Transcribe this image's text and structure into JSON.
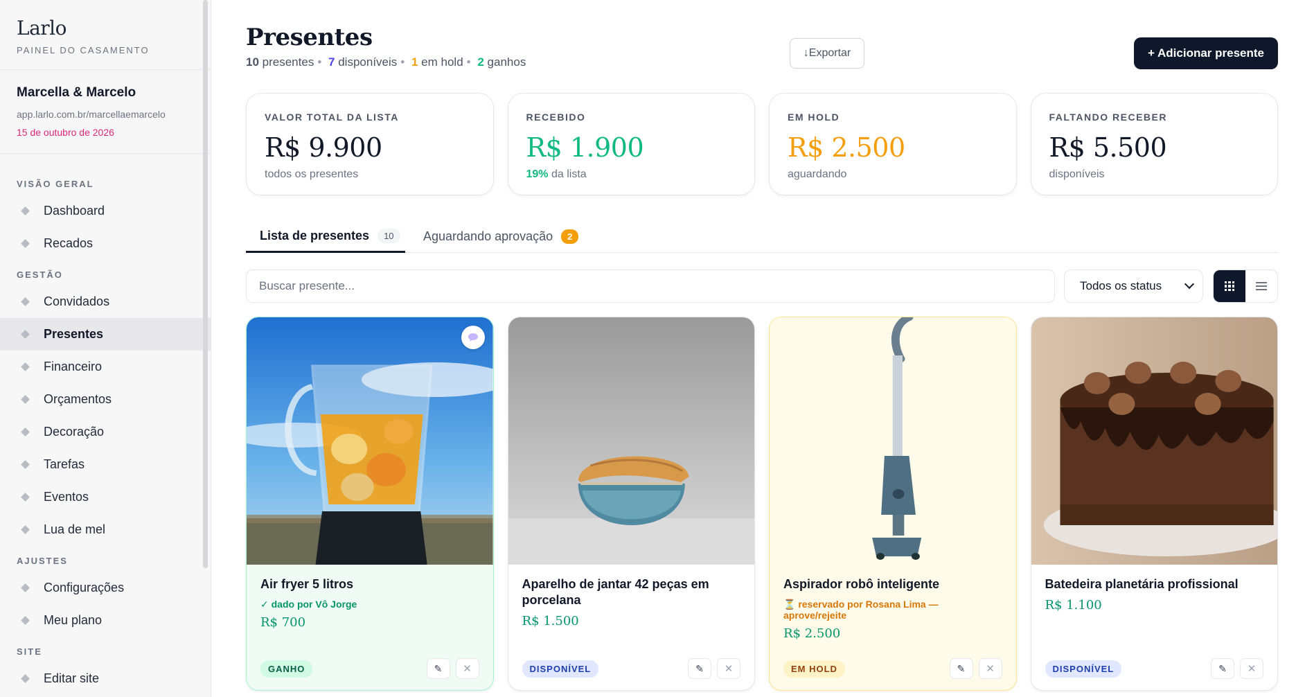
{
  "sidebar": {
    "brand": "Larlo",
    "brand_sub": "PAINEL DO CASAMENTO",
    "couple_name": "Marcella & Marcelo",
    "couple_url": "app.larlo.com.br/marcellaemarcelo",
    "wedding_date": "15 de outubro de 2026",
    "sections": [
      {
        "title": "VISÃO GERAL",
        "items": [
          "Dashboard",
          "Recados"
        ]
      },
      {
        "title": "GESTÃO",
        "items": [
          "Convidados",
          "Presentes",
          "Financeiro",
          "Orçamentos",
          "Decoração",
          "Tarefas",
          "Eventos",
          "Lua de mel"
        ]
      },
      {
        "title": "AJUSTES",
        "items": [
          "Configurações",
          "Meu plano"
        ]
      },
      {
        "title": "SITE",
        "items": [
          "Editar site"
        ]
      }
    ],
    "active_item": "Presentes"
  },
  "header": {
    "title": "Presentes",
    "summary": {
      "total": "10",
      "total_label": "presentes",
      "available": "7",
      "available_label": "disponíveis",
      "hold": "1",
      "hold_label": "em hold",
      "won": "2",
      "won_label": "ganhos"
    },
    "export_label": "↓Exportar",
    "add_label": "+ Adicionar presente"
  },
  "stats": [
    {
      "label": "VALOR TOTAL DA LISTA",
      "value": "R$ 9.900",
      "sub": "todos os presentes",
      "color": "#111827"
    },
    {
      "label": "RECEBIDO",
      "value": "R$ 1.900",
      "sub_highlight": "19%",
      "sub": "da lista",
      "color": "#10b981"
    },
    {
      "label": "EM HOLD",
      "value": "R$ 2.500",
      "sub": "aguardando",
      "color": "#f59e0b"
    },
    {
      "label": "FALTANDO RECEBER",
      "value": "R$ 5.500",
      "sub": "disponíveis",
      "color": "#111827"
    }
  ],
  "tabs": [
    {
      "label": "Lista de presentes",
      "count": "10"
    },
    {
      "label": "Aguardando aprovação",
      "count": "2"
    }
  ],
  "filters": {
    "search_placeholder": "Buscar presente...",
    "status_selected": "Todos os status"
  },
  "icons": {
    "grid_view": "grid-icon",
    "list_view": "list-icon",
    "edit": "edit-icon",
    "remove": "close-icon",
    "message": "message-icon",
    "nav_bullet": "diamond-icon"
  },
  "gifts": [
    {
      "title": "Air fryer 5 litros",
      "note": "✓ dado por Vô Jorge",
      "price": "R$ 700",
      "status": "GANHO",
      "image": "blender-with-fruit"
    },
    {
      "title": "Aparelho de jantar 42 peças em porcelana",
      "note": "",
      "price": "R$ 1.500",
      "status": "DISPONÍVEL",
      "image": "stacked-bowls"
    },
    {
      "title": "Aspirador robô inteligente",
      "note": "⏳ reservado por Rosana Lima — aprove/rejeite",
      "price": "R$ 2.500",
      "status": "EM HOLD",
      "image": "stick-vacuum"
    },
    {
      "title": "Batedeira planetária profissional",
      "note": "",
      "price": "R$ 1.100",
      "status": "DISPONÍVEL",
      "image": "chocolate-cake"
    }
  ]
}
